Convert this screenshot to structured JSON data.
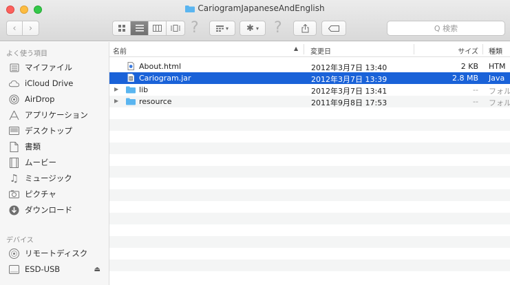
{
  "window": {
    "title": "CariogramJapaneseAndEnglish"
  },
  "toolbar": {
    "back_icon": "chevron-left-icon",
    "forward_icon": "chevron-right-icon",
    "view_modes": [
      "icon-view",
      "list-view",
      "column-view",
      "cover-flow-view"
    ],
    "active_view": "list-view",
    "search_placeholder": "Q 検索"
  },
  "sidebar": {
    "favorites_header": "よく使う項目",
    "favorites": [
      {
        "label": "マイファイル",
        "icon": "all-files-icon"
      },
      {
        "label": "iCloud Drive",
        "icon": "cloud-icon"
      },
      {
        "label": "AirDrop",
        "icon": "airdrop-icon"
      },
      {
        "label": "アプリケーション",
        "icon": "applications-icon"
      },
      {
        "label": "デスクトップ",
        "icon": "desktop-icon"
      },
      {
        "label": "書類",
        "icon": "documents-icon"
      },
      {
        "label": "ムービー",
        "icon": "movies-icon"
      },
      {
        "label": "ミュージック",
        "icon": "music-icon"
      },
      {
        "label": "ピクチャ",
        "icon": "pictures-icon"
      },
      {
        "label": "ダウンロード",
        "icon": "downloads-icon"
      }
    ],
    "devices_header": "デバイス",
    "devices": [
      {
        "label": "リモートディスク",
        "icon": "remote-disc-icon"
      },
      {
        "label": "ESD-USB",
        "icon": "drive-icon"
      }
    ]
  },
  "columns": {
    "name": "名前",
    "date": "変更日",
    "size": "サイズ",
    "kind": "種類"
  },
  "files": [
    {
      "name": "About.html",
      "date": "2012年3月7日 13:40",
      "size": "2 KB",
      "kind": "HTM",
      "type": "html"
    },
    {
      "name": "Cariogram.jar",
      "date": "2012年3月7日 13:39",
      "size": "2.8 MB",
      "kind": "Java",
      "type": "jar",
      "selected": true
    },
    {
      "name": "lib",
      "date": "2012年3月7日 13:41",
      "size": "--",
      "kind": "フォル",
      "type": "folder"
    },
    {
      "name": "resource",
      "date": "2011年9月8日 17:53",
      "size": "--",
      "kind": "フォル",
      "type": "folder"
    }
  ],
  "colors": {
    "selection": "#1a62d8",
    "folder": "#5ab5f0"
  }
}
